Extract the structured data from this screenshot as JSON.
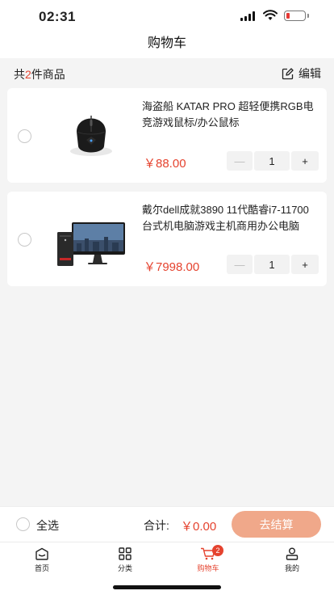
{
  "status_bar": {
    "time": "02:31"
  },
  "header": {
    "title": "购物车"
  },
  "summary": {
    "prefix": "共",
    "count": "2",
    "suffix": "件商品",
    "edit_label": "编辑"
  },
  "cart_items": [
    {
      "title": "海盗船 KATAR PRO 超轻便携RGB电竞游戏鼠标/办公鼠标",
      "price": "￥88.00",
      "quantity": "1",
      "image_icon": "gaming-mouse-image"
    },
    {
      "title": "戴尔dell成就3890 11代酷睿i7-11700 台式机电脑游戏主机商用办公电脑",
      "price": "￥7998.00",
      "quantity": "1",
      "image_icon": "desktop-computer-image"
    }
  ],
  "stepper": {
    "minus": "—",
    "plus": "+"
  },
  "checkout": {
    "select_all": "全选",
    "total_label": "合计:",
    "total_value": "￥0.00",
    "button_label": "去结算"
  },
  "tab_bar": {
    "tabs": [
      {
        "label": "首页",
        "icon": "home-icon"
      },
      {
        "label": "分类",
        "icon": "category-icon"
      },
      {
        "label": "购物车",
        "icon": "cart-icon",
        "badge": "2",
        "active": true
      },
      {
        "label": "我的",
        "icon": "profile-icon"
      }
    ]
  },
  "colors": {
    "accent": "#e5432f",
    "checkout_button": "#f0a88a",
    "background": "#f4f4f4"
  }
}
